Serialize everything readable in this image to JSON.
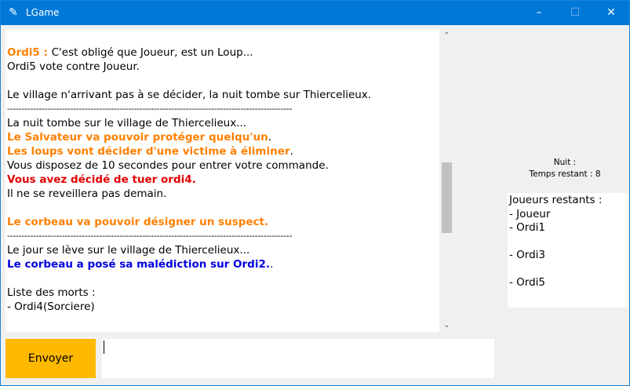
{
  "window": {
    "title": "LGame",
    "icon": "feather-icon",
    "controls": {
      "minimize": "–",
      "maximize": "☐",
      "close": "✕"
    }
  },
  "chat": {
    "lines": [
      {
        "segments": [
          {
            "text": "Ordi5 : ",
            "style": "orange"
          },
          {
            "text": "C'est obligé que Joueur, est un Loup...",
            "style": "normal"
          }
        ]
      },
      {
        "segments": [
          {
            "text": "Ordi5 vote contre Joueur.",
            "style": "normal"
          }
        ]
      },
      {
        "segments": [
          {
            "text": "",
            "style": "normal"
          }
        ]
      },
      {
        "segments": [
          {
            "text": "Le village n'arrivant pas à se décider, la nuit tombe sur Thiercelieux.",
            "style": "normal"
          }
        ]
      },
      {
        "segments": [
          {
            "text": "---------------------------------------------------------------------------------------------------",
            "style": "sep"
          }
        ]
      },
      {
        "segments": [
          {
            "text": "La nuit tombe sur le village de Thiercelieux...",
            "style": "normal"
          }
        ]
      },
      {
        "segments": [
          {
            "text": "Le Salvateur va pouvoir protéger quelqu'un",
            "style": "orange"
          },
          {
            "text": ".",
            "style": "normal"
          }
        ]
      },
      {
        "segments": [
          {
            "text": "Les loups vont décider d'une victime à éliminer",
            "style": "orange"
          },
          {
            "text": ".",
            "style": "normal"
          }
        ]
      },
      {
        "segments": [
          {
            "text": "Vous disposez de 10 secondes pour entrer votre commande.",
            "style": "normal"
          }
        ]
      },
      {
        "segments": [
          {
            "text": "Vous avez décidé de tuer ordi4.",
            "style": "red"
          }
        ]
      },
      {
        "segments": [
          {
            "text": "Il ne se reveillera pas demain.",
            "style": "normal"
          }
        ]
      },
      {
        "segments": [
          {
            "text": "",
            "style": "normal"
          }
        ]
      },
      {
        "segments": [
          {
            "text": "Le corbeau va pouvoir désigner un suspect.",
            "style": "orange"
          }
        ]
      },
      {
        "segments": [
          {
            "text": "---------------------------------------------------------------------------------------------------",
            "style": "sep"
          }
        ]
      },
      {
        "segments": [
          {
            "text": "Le jour se lève sur le village de Thiercelieux...",
            "style": "normal"
          }
        ]
      },
      {
        "segments": [
          {
            "text": "Le corbeau a posé sa malédiction sur Ordi2.",
            "style": "blue"
          },
          {
            "text": ".",
            "style": "normal"
          }
        ]
      },
      {
        "segments": [
          {
            "text": "",
            "style": "normal"
          }
        ]
      },
      {
        "segments": [
          {
            "text": "Liste des morts :",
            "style": "normal"
          }
        ]
      },
      {
        "segments": [
          {
            "text": "- Ordi4(Sorciere)",
            "style": "normal"
          }
        ]
      }
    ]
  },
  "scrollbar": {
    "up_arrow": "⌃",
    "down_arrow": "⌄",
    "position_fraction": 0.49
  },
  "status": {
    "phase": "Nuit :",
    "time_remaining": "Temps restant : 8"
  },
  "players": {
    "lines": [
      "Joueurs restants :",
      "- Joueur",
      "- Ordi1",
      "",
      "- Ordi3",
      "",
      "- Ordi5"
    ]
  },
  "command": {
    "send_label": "Envoyer",
    "input_value": ""
  }
}
